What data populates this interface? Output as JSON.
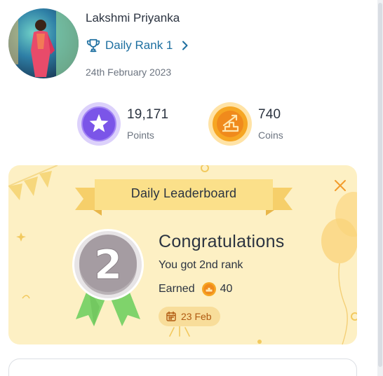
{
  "profile": {
    "name": "Lakshmi Priyanka",
    "rank_label": "Daily Rank 1",
    "date": "24th February 2023"
  },
  "stats": {
    "points": {
      "value": "19,171",
      "label": "Points",
      "icon": "star-icon"
    },
    "coins": {
      "value": "740",
      "label": "Coins",
      "icon": "coin-icon"
    }
  },
  "leaderboard": {
    "title": "Daily Leaderboard",
    "medal_number": "2",
    "heading": "Congratulations",
    "rank_message": "You got 2nd rank",
    "earned_label": "Earned",
    "earned_amount": "40",
    "date": "23 Feb"
  },
  "colors": {
    "link": "#1d6fa0",
    "card_background": "#fdf0c4",
    "banner": "#fbe08a",
    "accent_orange": "#f39c2c",
    "points_purple": "#7b55e8",
    "medal_green": "#7fd36b"
  }
}
